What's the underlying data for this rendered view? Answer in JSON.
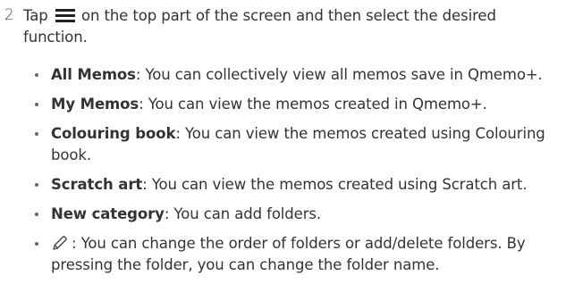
{
  "step": {
    "number": "2",
    "text_before_icon": "Tap",
    "icon": "menu-icon",
    "text_after_icon": "on the top part of the screen and then select the desired function."
  },
  "bullets": [
    {
      "term": "All Memos",
      "description": ": You can collectively view all memos save in Qmemo+."
    },
    {
      "term": "My Memos",
      "description": ": You can view the memos created in Qmemo+."
    },
    {
      "term": "Colouring book",
      "description": ": You can view the memos created using Colouring book."
    },
    {
      "term": "Scratch art",
      "description": ": You can view the memos created using Scratch art."
    },
    {
      "term": "New category",
      "description": ": You can add folders."
    },
    {
      "icon": "edit-pencil-icon",
      "description": ": You can change the order of folders or add/delete folders. By pressing the folder, you can change the folder name."
    }
  ]
}
